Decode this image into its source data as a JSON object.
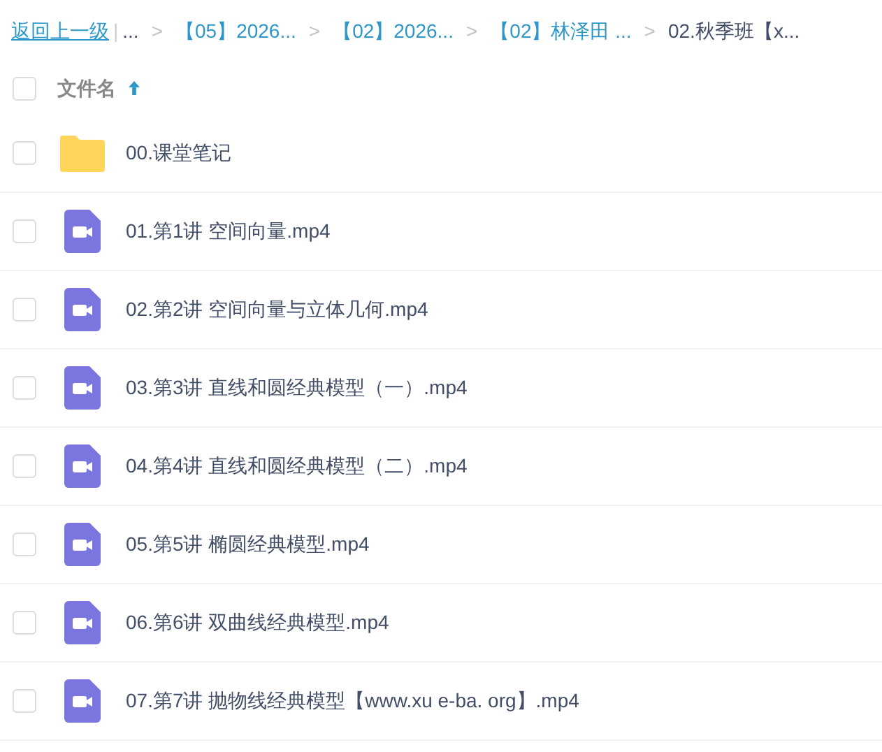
{
  "breadcrumb": {
    "back": "返回上一级",
    "divider": "|",
    "items": [
      {
        "text": "...",
        "kind": "plain"
      },
      {
        "sep": ">",
        "text": "【05】2026...",
        "kind": "link"
      },
      {
        "sep": ">",
        "text": "【02】2026...",
        "kind": "link"
      },
      {
        "sep": ">",
        "text": "【02】林泽田 ...",
        "kind": "link"
      },
      {
        "sep": ">",
        "text": "02.秋季班【x...",
        "kind": "current"
      }
    ]
  },
  "header": {
    "checked": false,
    "label": "文件名"
  },
  "files": [
    {
      "kind": "folder",
      "name": "00.课堂笔记",
      "checked": false
    },
    {
      "kind": "video",
      "name": "01.第1讲 空间向量.mp4",
      "checked": false
    },
    {
      "kind": "video",
      "name": "02.第2讲 空间向量与立体几何.mp4",
      "checked": false
    },
    {
      "kind": "video",
      "name": "03.第3讲 直线和圆经典模型（一）.mp4",
      "checked": false
    },
    {
      "kind": "video",
      "name": "04.第4讲 直线和圆经典模型（二）.mp4",
      "checked": false
    },
    {
      "kind": "video",
      "name": "05.第5讲 椭圆经典模型.mp4",
      "checked": false
    },
    {
      "kind": "video",
      "name": "06.第6讲 双曲线经典模型.mp4",
      "checked": false
    },
    {
      "kind": "video",
      "name": "07.第7讲 抛物线经典模型【www.xu e-ba. org】.mp4",
      "checked": false
    }
  ]
}
